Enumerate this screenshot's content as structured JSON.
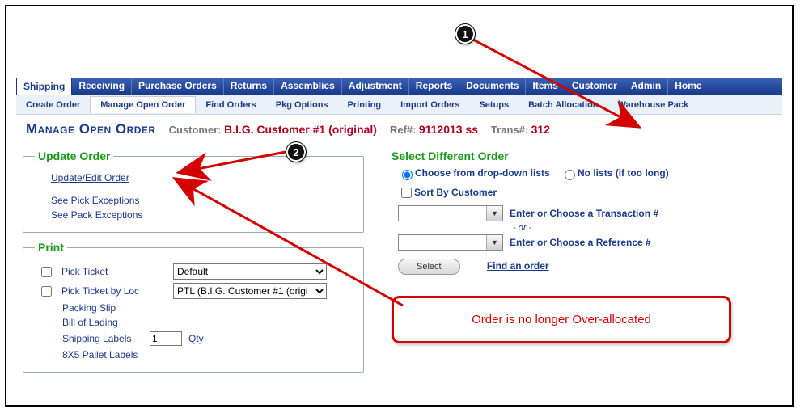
{
  "main_nav": [
    "Shipping",
    "Receiving",
    "Purchase Orders",
    "Returns",
    "Assemblies",
    "Adjustment",
    "Reports",
    "Documents",
    "Items",
    "Customer",
    "Admin",
    "Home"
  ],
  "main_nav_active_index": 0,
  "sub_nav": [
    "Create Order",
    "Manage Open Order",
    "Find Orders",
    "Pkg Options",
    "Printing",
    "Import Orders",
    "Setups",
    "Batch Allocation",
    "Warehouse Pack"
  ],
  "sub_nav_active_index": 1,
  "header": {
    "page_title": "Manage Open Order",
    "customer_label": "Customer:",
    "customer_value": "B.I.G. Customer #1 (original)",
    "ref_label": "Ref#:",
    "ref_value": "9112013 ss",
    "trans_label": "Trans#:",
    "trans_value": "312"
  },
  "update_order": {
    "legend": "Update Order",
    "update_edit": "Update/Edit Order",
    "pick_exceptions": "See Pick Exceptions",
    "pack_exceptions": "See Pack Exceptions"
  },
  "print": {
    "legend": "Print",
    "pick_ticket": "Pick Ticket",
    "pick_ticket_select": "Default",
    "pick_ticket_by_loc": "Pick Ticket by Loc",
    "pick_ticket_by_loc_select": "PTL (B.I.G. Customer #1 (origi",
    "packing_slip": "Packing Slip",
    "bill_of_lading": "Bill of Lading",
    "shipping_labels": "Shipping Labels",
    "shipping_labels_qty": "1",
    "qty_label": "Qty",
    "pallet_labels": "8X5 Pallet Labels"
  },
  "select_order": {
    "heading": "Select Different Order",
    "radio_choose": "Choose from drop-down lists",
    "radio_nolists": "No lists (if too long)",
    "sort_by_customer": "Sort By Customer",
    "trans_hint": "Enter or Choose a Transaction #",
    "or": "- or -",
    "ref_hint": "Enter or Choose a Reference #",
    "select_btn": "Select",
    "find_link": "Find an order"
  },
  "callout": {
    "text": "Order is no longer Over-allocated"
  },
  "badges": {
    "one": "1",
    "two": "2"
  }
}
